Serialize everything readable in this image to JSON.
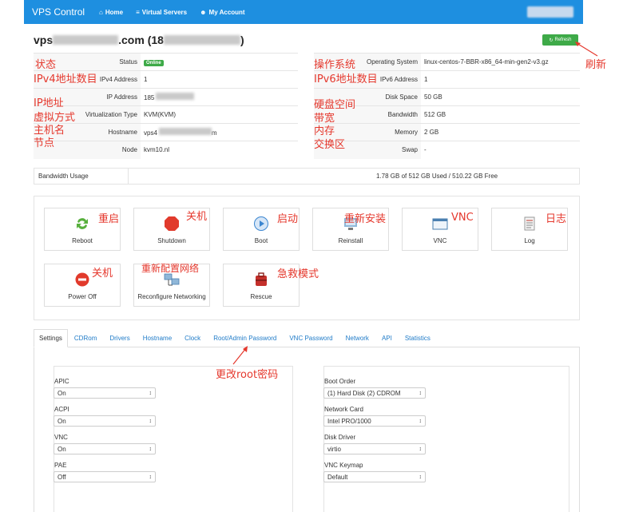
{
  "nav": {
    "brand": "VPS Control",
    "links": [
      {
        "icon": "home-icon",
        "glyph": "⌂",
        "label": "Home"
      },
      {
        "icon": "list-icon",
        "glyph": "≡",
        "label": "Virtual Servers"
      },
      {
        "icon": "user-icon",
        "glyph": "☻",
        "label": "My Account"
      }
    ]
  },
  "server": {
    "title_prefix": "vps",
    "title_mid": ".com (18",
    "title_suffix": ")",
    "refresh_label": "Refresh"
  },
  "left_info": [
    {
      "key": "Status",
      "value": "Online",
      "is_badge": true
    },
    {
      "key": "IPv4 Address",
      "value": "1"
    },
    {
      "key": "IP Address",
      "value": "185"
    },
    {
      "key": "Virtualization Type",
      "value": "KVM(KVM)"
    },
    {
      "key": "Hostname",
      "value": "vps4"
    },
    {
      "key": "Node",
      "value": "kvm10.nl"
    }
  ],
  "right_info": [
    {
      "key": "Operating System",
      "value": "linux-centos-7-BBR-x86_64-min-gen2-v3.gz"
    },
    {
      "key": "IPv6 Address",
      "value": "1"
    },
    {
      "key": "Disk Space",
      "value": "50 GB"
    },
    {
      "key": "Bandwidth",
      "value": "512 GB"
    },
    {
      "key": "Memory",
      "value": "2 GB"
    },
    {
      "key": "Swap",
      "value": "-"
    }
  ],
  "hostname_suffix": "m",
  "bandwidth": {
    "label": "Bandwidth Usage",
    "text": "1.78 GB of 512 GB Used / 510.22 GB Free"
  },
  "actions": [
    {
      "label": "Reboot",
      "icon": "reboot-icon",
      "anno": "重启"
    },
    {
      "label": "Shutdown",
      "icon": "shutdown-icon",
      "anno": "关机"
    },
    {
      "label": "Boot",
      "icon": "boot-icon",
      "anno": "启动"
    },
    {
      "label": "Reinstall",
      "icon": "reinstall-icon",
      "anno": "重新安装"
    },
    {
      "label": "VNC",
      "icon": "vnc-icon",
      "anno": "VNC"
    },
    {
      "label": "Log",
      "icon": "log-icon",
      "anno": "日志"
    },
    {
      "label": "Power Off",
      "icon": "power-off-icon",
      "anno": "关机"
    },
    {
      "label": "Reconfigure Networking",
      "icon": "network-icon",
      "anno": "重新配置网络"
    },
    {
      "label": "Rescue",
      "icon": "rescue-icon",
      "anno": "急救模式"
    }
  ],
  "tabs": [
    "Settings",
    "CDRom",
    "Drivers",
    "Hostname",
    "Clock",
    "Root/Admin Password",
    "VNC Password",
    "Network",
    "API",
    "Statistics"
  ],
  "settings_left": [
    {
      "label": "APIC",
      "value": "On"
    },
    {
      "label": "ACPI",
      "value": "On"
    },
    {
      "label": "VNC",
      "value": "On"
    },
    {
      "label": "PAE",
      "value": "Off"
    }
  ],
  "settings_right": [
    {
      "label": "Boot Order",
      "value": "(1) Hard Disk (2) CDROM"
    },
    {
      "label": "Network Card",
      "value": "Intel PRO/1000"
    },
    {
      "label": "Disk Driver",
      "value": "virtio"
    },
    {
      "label": "VNC Keymap",
      "value": "Default"
    }
  ],
  "annotations": {
    "status": "状态",
    "ipv4": "IPv4地址数目",
    "ip": "IP地址",
    "virt": "虚拟方式",
    "hostname": "主机名",
    "node": "节点",
    "os": "操作系统",
    "ipv6": "IPv6地址数目",
    "disk": "硬盘空间",
    "bandwidth": "带宽",
    "memory": "内存",
    "swap": "交换区",
    "refresh": "刷新",
    "root_pw": "更改root密码"
  },
  "colors": {
    "navbar": "#1e8fe0",
    "success": "#3eaa48",
    "annotation": "#e5382d",
    "link": "#1f7bc8"
  }
}
